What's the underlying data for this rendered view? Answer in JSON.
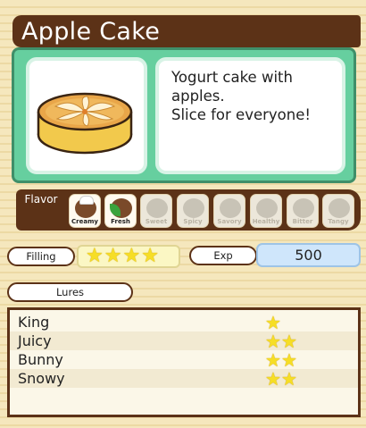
{
  "item": {
    "name": "Apple Cake",
    "description": "Yogurt cake with\napples.\nSlice for everyone!"
  },
  "flavor": {
    "label": "Flavor",
    "icons": [
      {
        "name": "Creamy",
        "active": true
      },
      {
        "name": "Fresh",
        "active": true
      },
      {
        "name": "Sweet",
        "active": false
      },
      {
        "name": "Spicy",
        "active": false
      },
      {
        "name": "Savory",
        "active": false
      },
      {
        "name": "Healthy",
        "active": false
      },
      {
        "name": "Bitter",
        "active": false
      },
      {
        "name": "Tangy",
        "active": false
      }
    ]
  },
  "stats": {
    "filling_label": "Filling",
    "filling_stars": 4,
    "exp_label": "Exp",
    "exp_value": "500"
  },
  "lures": {
    "label": "Lures",
    "rows": [
      {
        "name": "King",
        "stars": 1
      },
      {
        "name": "Juicy",
        "stars": 2
      },
      {
        "name": "Bunny",
        "stars": 2
      },
      {
        "name": "Snowy",
        "stars": 2
      }
    ]
  },
  "colors": {
    "title_bar": "#5c3217",
    "panel_green": "#66cf9f",
    "star_yellow": "#f6de26",
    "exp_blue": "#cfe6fb"
  }
}
